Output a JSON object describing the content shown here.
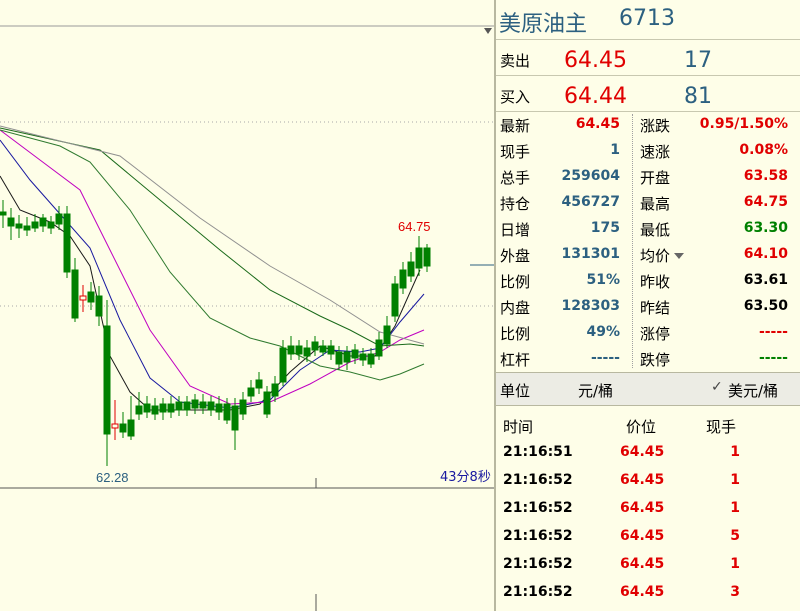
{
  "chart": {
    "high_label": "64.75",
    "low_label": "62.28",
    "timer": "43分8秒"
  },
  "quote": {
    "name": "美原油主",
    "code": "6713",
    "sell_label": "卖出",
    "sell_price": "64.45",
    "sell_vol": "17",
    "buy_label": "买入",
    "buy_price": "64.44",
    "buy_vol": "81",
    "rows": [
      {
        "l": "最新",
        "lv": "64.45",
        "lc": "red",
        "r": "涨跌",
        "rv": "0.95/1.50%",
        "rc": "red"
      },
      {
        "l": "现手",
        "lv": "1",
        "lc": "teal",
        "r": "速涨",
        "rv": "0.08%",
        "rc": "red"
      },
      {
        "l": "总手",
        "lv": "259604",
        "lc": "teal",
        "r": "开盘",
        "rv": "63.58",
        "rc": "red"
      },
      {
        "l": "持仓",
        "lv": "456727",
        "lc": "teal",
        "r": "最高",
        "rv": "64.75",
        "rc": "red"
      },
      {
        "l": "日增",
        "lv": "175",
        "lc": "teal",
        "r": "最低",
        "rv": "63.30",
        "rc": "green"
      },
      {
        "l": "外盘",
        "lv": "131301",
        "lc": "teal",
        "r": "均价",
        "rv": "64.10",
        "rc": "red"
      },
      {
        "l": "比例",
        "lv": "51%",
        "lc": "teal",
        "r": "昨收",
        "rv": "63.61",
        "rc": "black"
      },
      {
        "l": "内盘",
        "lv": "128303",
        "lc": "teal",
        "r": "昨结",
        "rv": "63.50",
        "rc": "black"
      },
      {
        "l": "比例",
        "lv": "49%",
        "lc": "teal",
        "r": "涨停",
        "rv": "-----",
        "rc": "red"
      },
      {
        "l": "杠杆",
        "lv": "-----",
        "lc": "teal",
        "r": "跌停",
        "rv": "-----",
        "rc": "green"
      }
    ],
    "unit_label": "单位",
    "unit_cny": "元/桶",
    "unit_usd": "美元/桶",
    "check_glyph": "✓"
  },
  "ticks": {
    "headers": {
      "time": "时间",
      "price": "价位",
      "vol": "现手"
    },
    "rows": [
      {
        "time": "21:16:51",
        "price": "64.45",
        "vol": "1"
      },
      {
        "time": "21:16:52",
        "price": "64.45",
        "vol": "1"
      },
      {
        "time": "21:16:52",
        "price": "64.45",
        "vol": "1"
      },
      {
        "time": "21:16:52",
        "price": "64.45",
        "vol": "5"
      },
      {
        "time": "21:16:52",
        "price": "64.45",
        "vol": "1"
      },
      {
        "time": "21:16:52",
        "price": "64.45",
        "vol": "3"
      }
    ]
  },
  "colors": {
    "up": "#e00000",
    "down": "#008000",
    "accent": "#2c6080"
  }
}
